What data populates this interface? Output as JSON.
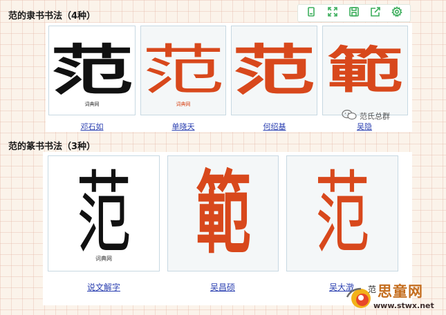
{
  "headings": {
    "lishu": "范的隶书书法（4种）",
    "zhuanshu": "范的篆书书法（3种）"
  },
  "toolbar": {
    "icons": [
      "copy-icon",
      "expand-icon",
      "save-icon",
      "share-icon",
      "settings-icon"
    ]
  },
  "lishu_cards": [
    {
      "glyph": "范",
      "caption": "邓石如",
      "watermark": "词典网",
      "color": "#111111"
    },
    {
      "glyph": "范",
      "caption": "单晓天",
      "watermark": "词典网",
      "color": "#d8481c"
    },
    {
      "glyph": "范",
      "caption": "何绍基",
      "watermark": "",
      "color": "#d8481c"
    },
    {
      "glyph": "範",
      "caption": "吴隐",
      "watermark": "",
      "color": "#d8481c"
    }
  ],
  "zhuan_cards": [
    {
      "glyph": "范",
      "caption": "说文解字",
      "watermark": "词典网",
      "color": "#111111"
    },
    {
      "glyph": "範",
      "caption": "吴昌硕",
      "watermark": "",
      "color": "#d8481c"
    },
    {
      "glyph": "范",
      "caption": "吴大澂",
      "watermark": "",
      "color": "#d8481c"
    }
  ],
  "wechat_watermark": "范氏总群",
  "site": {
    "overlay": "范",
    "title": "思童网",
    "url": "www.stwx.net"
  },
  "colors": {
    "toolbar_icon": "#3cae5c",
    "link": "#2a3fb0",
    "seal_red": "#d8481c"
  }
}
